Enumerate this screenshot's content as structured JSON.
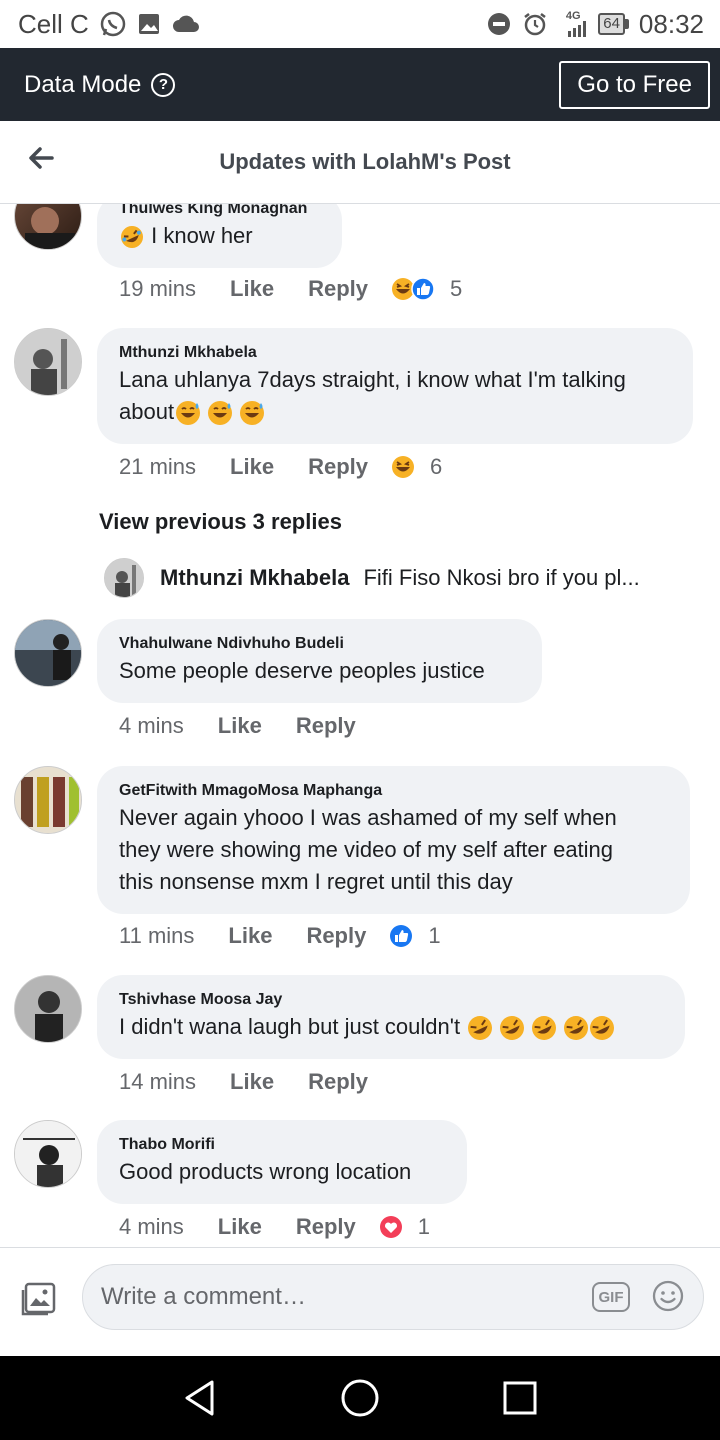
{
  "status_bar": {
    "carrier": "Cell C",
    "network": "4G",
    "battery": "64",
    "time": "08:32",
    "icons": [
      "whatsapp-icon",
      "gallery-icon",
      "cloud-icon",
      "dnd-icon",
      "alarm-icon",
      "signal-icon",
      "battery-icon"
    ]
  },
  "data_bar": {
    "label": "Data Mode",
    "help": "?",
    "go_free": "Go to Free"
  },
  "header": {
    "title": "Updates with LolahM's Post"
  },
  "comments": [
    {
      "name": "Thulwes King Monaghan",
      "text": "I know her",
      "time": "19 mins",
      "like": "Like",
      "reply": "Reply",
      "reactions": [
        "haha",
        "like"
      ],
      "count": "5"
    },
    {
      "name": "Mthunzi Mkhabela",
      "text_line1": "Lana uhlanya 7days straight, i know what I'm talking",
      "text_line2": "about",
      "time": "21 mins",
      "like": "Like",
      "reply": "Reply",
      "reactions": [
        "haha"
      ],
      "count": "6"
    },
    {
      "name": "Vhahulwane Ndivhuho Budeli",
      "text": "Some people deserve peoples justice",
      "time": "4 mins",
      "like": "Like",
      "reply": "Reply"
    },
    {
      "name": "GetFitwith MmagoMosa Maphanga",
      "text_line1": "Never again yhooo  I was ashamed of my self when",
      "text_line2": "they were showing me video of my self after eating",
      "text_line3": "this nonsense mxm I regret until this day",
      "time": "11 mins",
      "like": "Like",
      "reply": "Reply",
      "reactions": [
        "like"
      ],
      "count": "1"
    },
    {
      "name": "Tshivhase Moosa Jay",
      "text": "I didn't wana laugh but just couldn't",
      "time": "14 mins",
      "like": "Like",
      "reply": "Reply"
    },
    {
      "name": "Thabo Morifi",
      "text": "Good products wrong location",
      "time": "4 mins",
      "like": "Like",
      "reply": "Reply",
      "reactions": [
        "love"
      ],
      "count": "1"
    }
  ],
  "view_previous": "View previous 3 replies",
  "reply_preview": {
    "name": "Mthunzi Mkhabela",
    "text": "Fifi Fiso Nkosi bro if you pl..."
  },
  "composer": {
    "placeholder": "Write a comment…",
    "gif": "GIF"
  },
  "colors": {
    "data_bar_bg": "#222830",
    "bubble_bg": "#f0f2f5",
    "like_blue": "#1877f2",
    "love_red": "#f33e58",
    "haha_yellow": "#f7b125"
  }
}
